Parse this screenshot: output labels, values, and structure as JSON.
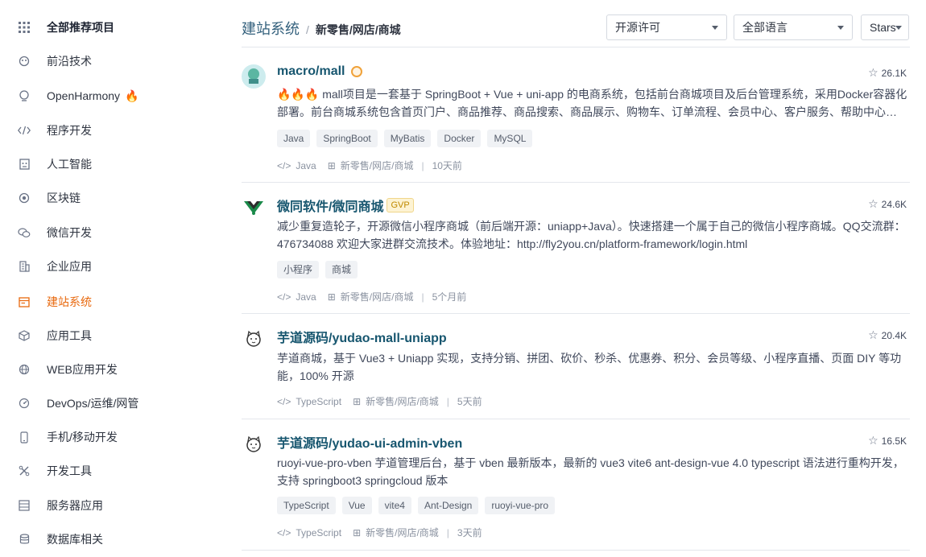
{
  "sidebar": {
    "items": [
      {
        "label": "全部推荐项目",
        "icon": "grid-icon"
      },
      {
        "label": "前沿技术",
        "icon": "frontier-icon"
      },
      {
        "label": "OpenHarmony",
        "icon": "harmony-icon",
        "hot": "🔥"
      },
      {
        "label": "程序开发",
        "icon": "code-icon"
      },
      {
        "label": "人工智能",
        "icon": "robot-icon"
      },
      {
        "label": "区块链",
        "icon": "blockchain-icon"
      },
      {
        "label": "微信开发",
        "icon": "wechat-icon"
      },
      {
        "label": "企业应用",
        "icon": "building-icon"
      },
      {
        "label": "建站系统",
        "icon": "website-icon"
      },
      {
        "label": "应用工具",
        "icon": "cube-icon"
      },
      {
        "label": "WEB应用开发",
        "icon": "globe-icon"
      },
      {
        "label": "DevOps/运维/网管",
        "icon": "gauge-icon"
      },
      {
        "label": "手机/移动开发",
        "icon": "phone-icon"
      },
      {
        "label": "开发工具",
        "icon": "tools-icon"
      },
      {
        "label": "服务器应用",
        "icon": "server-icon"
      },
      {
        "label": "数据库相关",
        "icon": "database-icon"
      }
    ],
    "active_index": 8
  },
  "header": {
    "breadcrumb_root": "建站系统",
    "breadcrumb_sep": "/",
    "breadcrumb_current": "新零售/网店/商城",
    "filter_license": "开源许可",
    "filter_language": "全部语言",
    "sort": "Stars"
  },
  "projects": [
    {
      "title": "macro/mall",
      "badge": "medal",
      "stars": "26.1K",
      "desc_prefix": "🔥🔥🔥",
      "description": "mall项目是一套基于 SpringBoot + Vue + uni-app 的电商系统，包括前台商城项目及后台管理系统，采用Docker容器化部署。前台商城系统包含首页门户、商品推荐、商品搜索、商品展示、购物车、订单流程、会员中心、客户服务、帮助中心…",
      "tags": [
        "Java",
        "SpringBoot",
        "MyBatis",
        "Docker",
        "MySQL"
      ],
      "language": "Java",
      "category": "新零售/网店/商城",
      "updated": "10天前"
    },
    {
      "title": "微同软件/微同商城",
      "badge": "GVP",
      "stars": "24.6K",
      "desc_prefix": "",
      "description": "减少重复造轮子，开源微信小程序商城（前后端开源：uniapp+Java）。快速搭建一个属于自己的微信小程序商城。QQ交流群：476734088 欢迎大家进群交流技术。体验地址：http://fly2you.cn/platform-framework/login.html",
      "tags": [
        "小程序",
        "商城"
      ],
      "language": "Java",
      "category": "新零售/网店/商城",
      "updated": "5个月前"
    },
    {
      "title": "芋道源码/yudao-mall-uniapp",
      "badge": "",
      "stars": "20.4K",
      "desc_prefix": "",
      "description": "芋道商城，基于 Vue3 + Uniapp 实现，支持分销、拼团、砍价、秒杀、优惠券、积分、会员等级、小程序直播、页面 DIY 等功能，100% 开源",
      "tags": [],
      "language": "TypeScript",
      "category": "新零售/网店/商城",
      "updated": "5天前"
    },
    {
      "title": "芋道源码/yudao-ui-admin-vben",
      "badge": "",
      "stars": "16.5K",
      "desc_prefix": "",
      "description": "ruoyi-vue-pro-vben 芋道管理后台，基于 vben 最新版本，最新的 vue3 vite6 ant-design-vue 4.0 typescript 语法进行重构开发，支持 springboot3 springcloud 版本",
      "tags": [
        "TypeScript",
        "Vue",
        "vite4",
        "Ant-Design",
        "ruoyi-vue-pro"
      ],
      "language": "TypeScript",
      "category": "新零售/网店/商城",
      "updated": "3天前"
    }
  ],
  "colors": {
    "active": "#e8690f",
    "title": "#17566f",
    "breadcrumb": "#34617d"
  }
}
